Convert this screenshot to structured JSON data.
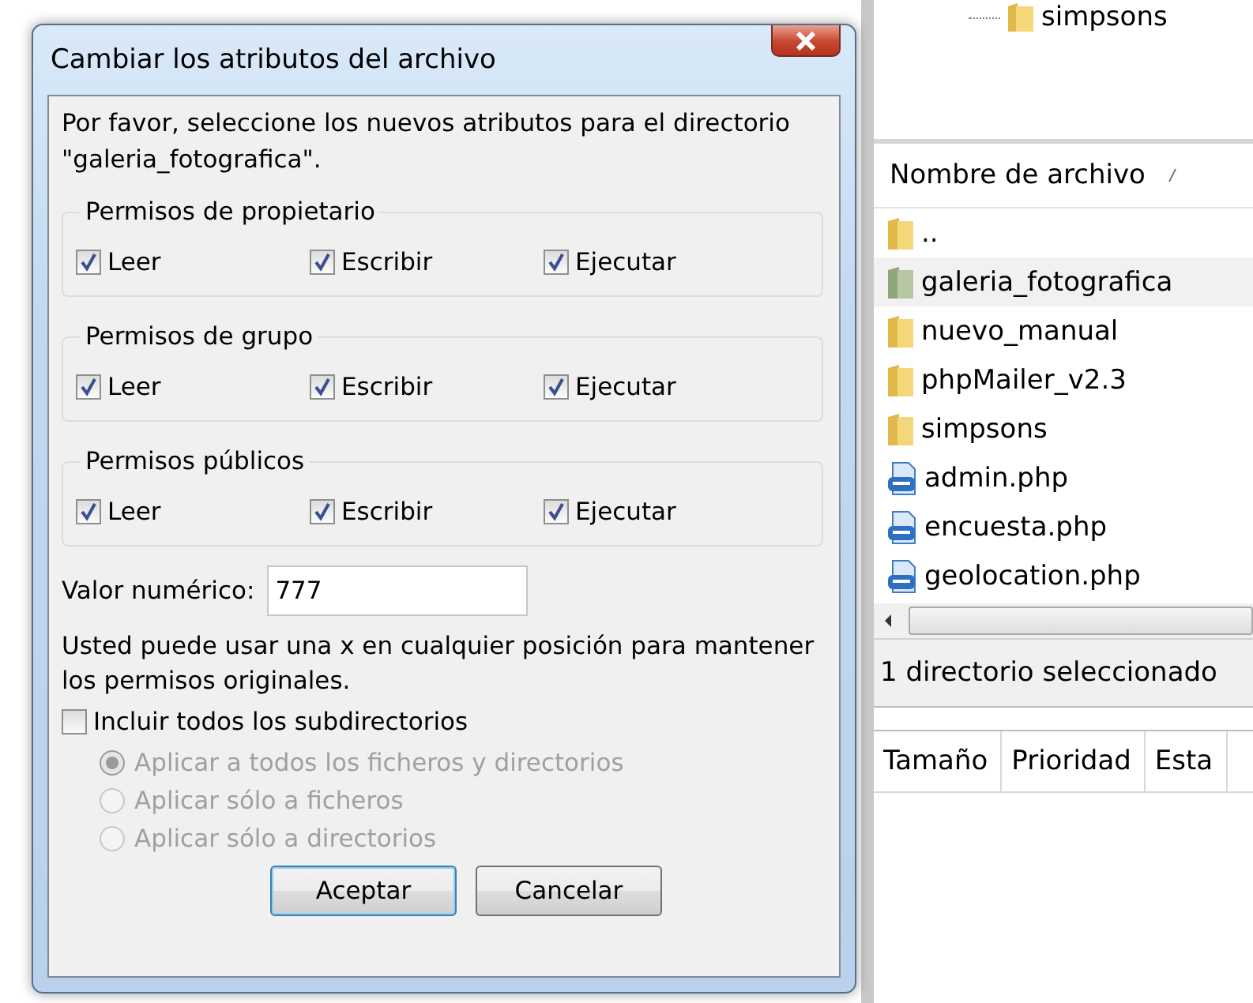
{
  "dialog": {
    "title": "Cambiar los atributos del archivo",
    "intro": "Por favor, seleccione los nuevos atributos para el directorio \"galeria_fotografica\".",
    "groups": [
      {
        "title": "Permisos de propietario",
        "options": [
          {
            "label": "Leer",
            "checked": true
          },
          {
            "label": "Escribir",
            "checked": true
          },
          {
            "label": "Ejecutar",
            "checked": true
          }
        ]
      },
      {
        "title": "Permisos de grupo",
        "options": [
          {
            "label": "Leer",
            "checked": true
          },
          {
            "label": "Escribir",
            "checked": true
          },
          {
            "label": "Ejecutar",
            "checked": true
          }
        ]
      },
      {
        "title": "Permisos públicos",
        "options": [
          {
            "label": "Leer",
            "checked": true
          },
          {
            "label": "Escribir",
            "checked": true
          },
          {
            "label": "Ejecutar",
            "checked": true
          }
        ]
      }
    ],
    "numeric": {
      "label": "Valor numérico:",
      "value": "777"
    },
    "note": "Usted puede usar una x en cualquier posición para mantener los permisos originales.",
    "subdirs": {
      "label": "Incluir todos los subdirectorios",
      "checked": false
    },
    "apply_options": [
      {
        "label": "Aplicar a todos los ficheros y directorios",
        "selected": true,
        "disabled": true
      },
      {
        "label": "Aplicar sólo a ficheros",
        "selected": false,
        "disabled": true
      },
      {
        "label": "Aplicar sólo a directorios",
        "selected": false,
        "disabled": true
      }
    ],
    "buttons": [
      {
        "label": "Aceptar",
        "default": true
      },
      {
        "label": "Cancelar",
        "default": false
      }
    ]
  },
  "background": {
    "tree_item": "simpsons",
    "file_list": {
      "column": "Nombre de archivo",
      "rows": [
        {
          "name": "..",
          "kind": "folder",
          "selected": false
        },
        {
          "name": "galeria_fotografica",
          "kind": "folder",
          "selected": true
        },
        {
          "name": "nuevo_manual",
          "kind": "folder",
          "selected": false
        },
        {
          "name": "phpMailer_v2.3",
          "kind": "folder",
          "selected": false
        },
        {
          "name": "simpsons",
          "kind": "folder",
          "selected": false
        },
        {
          "name": "admin.php",
          "kind": "php",
          "selected": false
        },
        {
          "name": "encuesta.php",
          "kind": "php",
          "selected": false
        },
        {
          "name": "geolocation.php",
          "kind": "php",
          "selected": false
        }
      ]
    },
    "status": "1 directorio seleccionado",
    "queue_columns": [
      "Tamaño",
      "Prioridad",
      "Esta"
    ]
  }
}
